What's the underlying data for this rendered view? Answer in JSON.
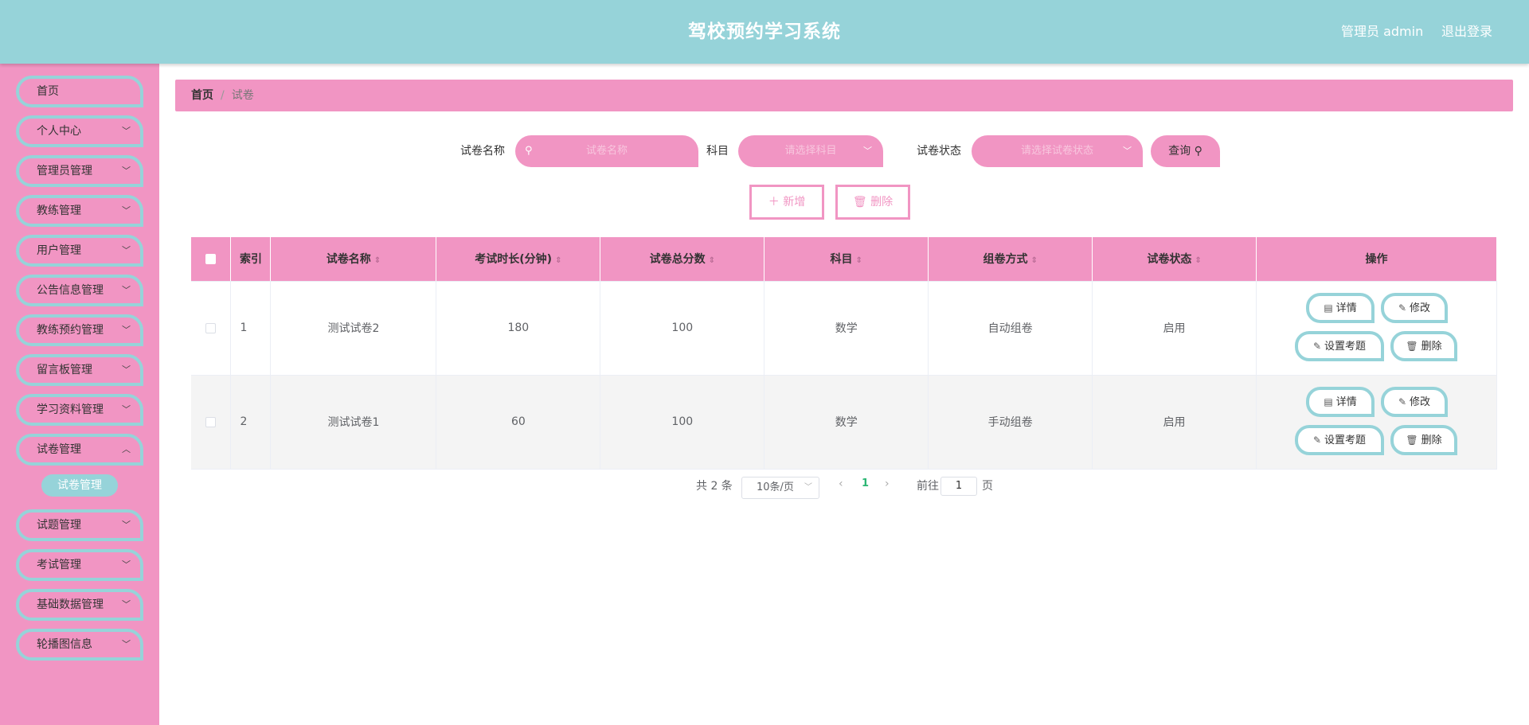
{
  "header": {
    "title": "驾校预约学习系统",
    "user": "管理员 admin",
    "logout": "退出登录"
  },
  "sidebar": {
    "items": [
      {
        "label": "首页"
      },
      {
        "label": "个人中心"
      },
      {
        "label": "管理员管理"
      },
      {
        "label": "教练管理"
      },
      {
        "label": "用户管理"
      },
      {
        "label": "公告信息管理"
      },
      {
        "label": "教练预约管理"
      },
      {
        "label": "留言板管理"
      },
      {
        "label": "学习资料管理"
      },
      {
        "label": "试卷管理"
      },
      {
        "label": "试题管理"
      },
      {
        "label": "考试管理"
      },
      {
        "label": "基础数据管理"
      },
      {
        "label": "轮播图信息"
      }
    ],
    "submenu": "试卷管理"
  },
  "breadcrumb": {
    "home": "首页",
    "separator": "/",
    "current": "试卷"
  },
  "search": {
    "name_label": "试卷名称",
    "name_placeholder": "试卷名称",
    "subject_label": "科目",
    "subject_placeholder": "请选择科目",
    "status_label": "试卷状态",
    "status_placeholder": "请选择试卷状态",
    "query_label": "查询"
  },
  "actions": {
    "add": "新增",
    "delete": "删除"
  },
  "table": {
    "headers": [
      "索引",
      "试卷名称",
      "考试时长(分钟)",
      "试卷总分数",
      "科目",
      "组卷方式",
      "试卷状态",
      "操作"
    ],
    "rows": [
      {
        "index": "1",
        "name": "测试试卷2",
        "duration": "180",
        "score": "100",
        "subject": "数学",
        "mode": "自动组卷",
        "status": "启用"
      },
      {
        "index": "2",
        "name": "测试试卷1",
        "duration": "60",
        "score": "100",
        "subject": "数学",
        "mode": "手动组卷",
        "status": "启用"
      }
    ],
    "ops": {
      "detail": "详情",
      "edit": "修改",
      "set_questions": "设置考题",
      "delete": "删除"
    }
  },
  "pagination": {
    "total": "共 2 条",
    "page_size": "10条/页",
    "current": "1",
    "goto": "前往",
    "goto_value": "1",
    "page_unit": "页"
  },
  "colors": {
    "accent_teal": "#96d3d9",
    "accent_pink": "#f195c3"
  }
}
